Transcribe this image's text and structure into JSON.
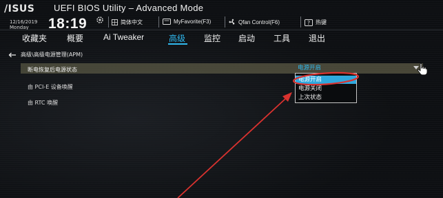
{
  "header": {
    "logo": "/ISUS",
    "title": "UEFI BIOS Utility – Advanced Mode",
    "date": "12/16/2019",
    "day": "Monday",
    "time": "18:19",
    "language": "简体中文",
    "myfavorite": "MyFavorite(F3)",
    "qfan": "Qfan Control(F6)",
    "hotkeys": "热键"
  },
  "menu": {
    "items": [
      "收藏夹",
      "概要",
      "Ai Tweaker",
      "高级",
      "监控",
      "启动",
      "工具",
      "退出"
    ],
    "active_index": 3
  },
  "breadcrumb": "高级\\高级电源管理(APM)",
  "settings": {
    "rows": [
      {
        "label": "断电恢复后电源状态",
        "value": "电源开启"
      },
      {
        "label": "由 PCI-E 设备唤醒"
      },
      {
        "label": "由 RTC 唤醒"
      }
    ]
  },
  "dropdown": {
    "options": [
      "电源开启",
      "电源关闭",
      "上次状态"
    ],
    "selected_index": 0
  },
  "colors": {
    "accent": "#2fb9ef",
    "highlight_row": "#76724f",
    "annotation": "#d9322f"
  },
  "icons": {
    "back": "arrow-left-icon",
    "settings": "gear-icon",
    "language": "globe-icon",
    "favorite": "star-icon",
    "fan": "fan-icon",
    "help": "question-icon",
    "cursor": "hand-pointer-icon"
  }
}
